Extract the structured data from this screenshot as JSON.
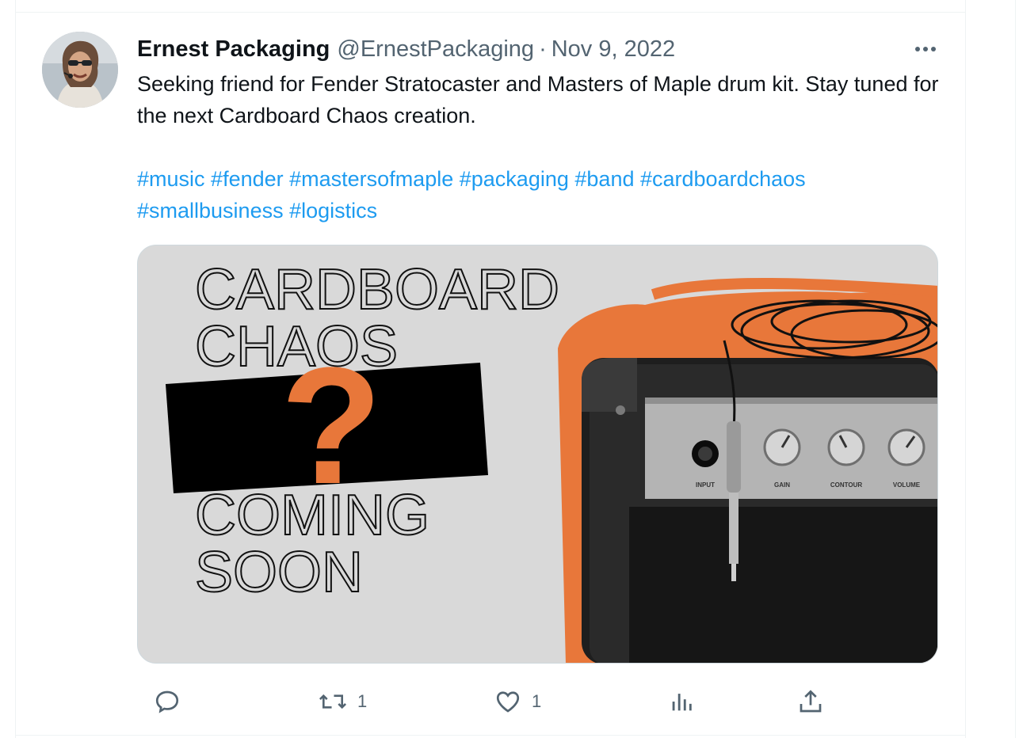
{
  "tweet": {
    "display_name": "Ernest Packaging",
    "handle": "@ErnestPackaging",
    "separator": "·",
    "date": "Nov 9, 2022",
    "text": "Seeking friend for Fender Stratocaster and Masters of Maple drum kit. Stay tuned for the next Cardboard Chaos creation.",
    "hashtags": [
      "#music",
      "#fender",
      "#mastersofmaple",
      "#packaging",
      "#band",
      "#cardboardchaos",
      "#smallbusiness",
      "#logistics"
    ],
    "media": {
      "headline_line1": "CARDBOARD",
      "headline_line2": "CHAOS",
      "question_mark": "?",
      "footer_line1": "COMING",
      "footer_line2": "SOON",
      "amp_label_input": "INPUT",
      "amp_label_gain": "GAIN",
      "amp_label_contour": "CONTOUR",
      "amp_label_volume": "VOLUME",
      "accent_color": "#e8773a"
    },
    "actions": {
      "reply_icon": "reply-icon",
      "retweet_count": "1",
      "like_count": "1",
      "views_icon": "views-icon",
      "share_icon": "share-icon"
    }
  },
  "colors": {
    "link": "#1d9bf0",
    "text": "#0f1419",
    "secondary": "#536471"
  }
}
